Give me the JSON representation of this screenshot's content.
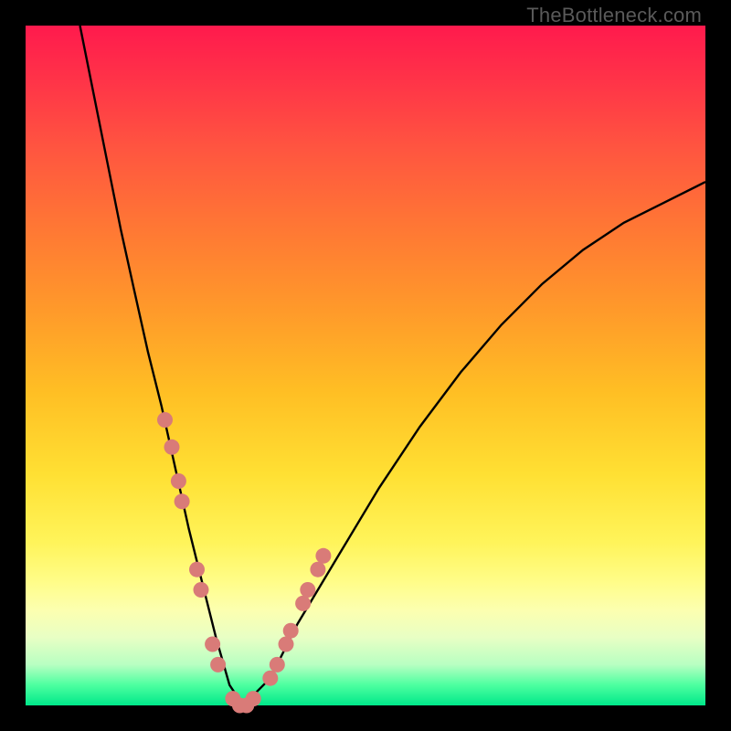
{
  "watermark": "TheBottleneck.com",
  "chart_data": {
    "type": "line",
    "title": "",
    "xlabel": "",
    "ylabel": "",
    "xlim": [
      0,
      100
    ],
    "ylim": [
      0,
      100
    ],
    "grid": false,
    "legend": false,
    "series": [
      {
        "name": "bottleneck-curve",
        "x": [
          8,
          10,
          12,
          14,
          16,
          18,
          20,
          22,
          24,
          26,
          28,
          30,
          32,
          36,
          40,
          46,
          52,
          58,
          64,
          70,
          76,
          82,
          88,
          94,
          100
        ],
        "y": [
          100,
          90,
          80,
          70,
          61,
          52,
          44,
          35,
          26,
          18,
          10,
          3,
          0,
          4,
          12,
          22,
          32,
          41,
          49,
          56,
          62,
          67,
          71,
          74,
          77
        ]
      }
    ],
    "markers": {
      "name": "highlight-dots",
      "color": "#d97b78",
      "x": [
        20.5,
        21.5,
        22.5,
        23.0,
        25.2,
        25.8,
        27.5,
        28.3,
        30.5,
        31.5,
        32.5,
        33.5,
        36.0,
        37.0,
        38.3,
        39.0,
        40.8,
        41.5,
        43.0,
        43.8
      ],
      "y": [
        42,
        38,
        33,
        30,
        20,
        17,
        9,
        6,
        1,
        0,
        0,
        1,
        4,
        6,
        9,
        11,
        15,
        17,
        20,
        22
      ]
    },
    "background_gradient": {
      "top": "#ff1a4d",
      "bottom": "#00e88a"
    }
  }
}
